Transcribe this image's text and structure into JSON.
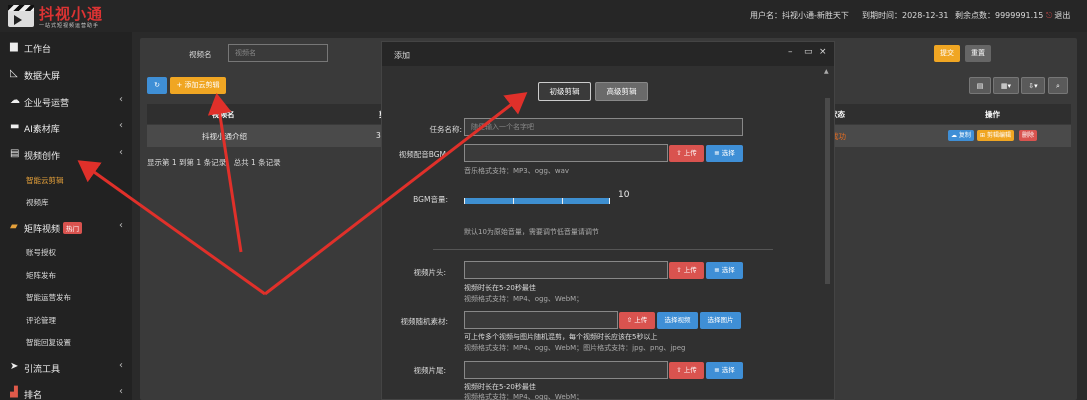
{
  "app": {
    "logo_title": "抖视小通",
    "logo_subtitle": "一站式短视频运营助手"
  },
  "header": {
    "username": "用户名：抖视小通-新胜天下",
    "expiry": "到期时间：2028-12-31",
    "points": "剩余点数：9999991.15",
    "logout": "退出"
  },
  "sidebar": {
    "items": [
      {
        "label": "工作台",
        "icon": "desktop-icon"
      },
      {
        "label": "数据大屏",
        "icon": "chart-icon"
      },
      {
        "label": "企业号运营",
        "icon": "cloud-icon"
      },
      {
        "label": "AI素材库",
        "icon": "folder-icon"
      },
      {
        "label": "视频创作",
        "icon": "film-icon"
      }
    ],
    "video_sub": [
      "智能云剪辑",
      "视频库"
    ],
    "matrix": {
      "label": "矩阵视频",
      "badge": "热门",
      "icon": "video-icon"
    },
    "matrix_sub": [
      "账号授权",
      "矩阵发布",
      "智能运营发布",
      "评论管理",
      "智能回复设置"
    ],
    "items2": [
      {
        "label": "引流工具",
        "icon": "send-icon"
      },
      {
        "label": "排名",
        "icon": "bar-icon"
      }
    ]
  },
  "filter": {
    "label": "视频名",
    "placeholder": "视频名",
    "submit": "提交",
    "reset": "重置"
  },
  "toolbar": {
    "add_label": "+ 添加云剪辑"
  },
  "table": {
    "headers": [
      "视频名",
      "剪辑",
      "状态",
      "操作"
    ],
    "row": {
      "name": "抖视小通介绍",
      "clip": "3",
      "status": "成功"
    },
    "actions": [
      "复制",
      "剪辑编辑",
      "删除"
    ],
    "summary": "显示第 1 到第 1 条记录，总共 1 条记录"
  },
  "modal": {
    "title": "添加",
    "tab_basic": "初级剪辑",
    "tab_advanced": "高级剪辑",
    "task_label": "任务名称:",
    "task_placeholder": "随便输入一个名字吧",
    "bgm_label": "视频配音BGM",
    "bgm_help": "音乐格式支持：MP3、ogg、wav",
    "volume_label": "BGM音量:",
    "volume_value": "10",
    "volume_help": "默认10为原始音量，需要调节低音量请调节",
    "head_label": "视频片头:",
    "head_help1": "视频时长在5-20秒最佳",
    "head_help2": "视频格式支持：MP4、ogg、WebM；",
    "random_label": "视频随机素材:",
    "random_help1": "可上传多个视频与图片随机混剪，每个视频时长应该在5秒以上",
    "random_help2": "视频格式支持：MP4、ogg、WebM；图片格式支持：jpg、png、jpeg",
    "tail_label": "视频片尾:",
    "tail_help1": "视频时长在5-20秒最佳",
    "tail_help2": "视频格式支持：MP4、ogg、WebM；",
    "upload": "上传",
    "select": "选择",
    "select_video": "选择视频",
    "select_image": "选择图片"
  },
  "colors": {
    "accent": "#f0a623",
    "primary": "#3f8fd6",
    "danger": "#d9534f",
    "arrow": "#e0302a"
  }
}
